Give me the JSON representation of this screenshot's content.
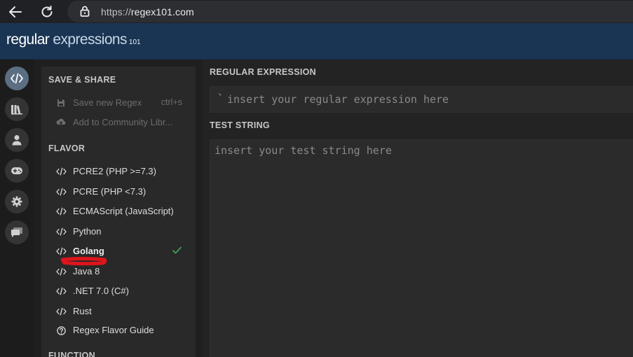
{
  "browser": {
    "url_protocol": "https://",
    "url_host": "regex101.com"
  },
  "header": {
    "brand_main": "regular",
    "brand_light": "expressions",
    "brand_sub": "101"
  },
  "rail": {
    "items": [
      {
        "icon": "code-icon",
        "active": true
      },
      {
        "icon": "library-icon",
        "active": false
      },
      {
        "icon": "user-icon",
        "active": false
      },
      {
        "icon": "gamepad-icon",
        "active": false
      },
      {
        "icon": "gear-icon",
        "active": false
      },
      {
        "icon": "chat-icon",
        "active": false
      }
    ]
  },
  "sidebar": {
    "save_share_title": "SAVE & SHARE",
    "save_new": "Save new Regex",
    "save_shortcut": "ctrl+s",
    "add_community": "Add to Community Libr...",
    "flavor_title": "FLAVOR",
    "flavors": [
      {
        "label": "PCRE2 (PHP >=7.3)",
        "selected": false
      },
      {
        "label": "PCRE (PHP <7.3)",
        "selected": false
      },
      {
        "label": "ECMAScript (JavaScript)",
        "selected": false
      },
      {
        "label": "Python",
        "selected": false
      },
      {
        "label": "Golang",
        "selected": true
      },
      {
        "label": "Java 8",
        "selected": false
      },
      {
        "label": ".NET 7.0 (C#)",
        "selected": false
      },
      {
        "label": "Rust",
        "selected": false
      }
    ],
    "flavor_guide": "Regex Flavor Guide",
    "function_title": "FUNCTION"
  },
  "main": {
    "regex_title": "REGULAR EXPRESSION",
    "regex_delimiter": "`",
    "regex_placeholder": "insert your regular expression here",
    "test_title": "TEST STRING",
    "test_placeholder": "insert your test string here"
  },
  "colors": {
    "header_bg": "#1a3553",
    "rail_active": "#5b6e82",
    "check_green": "#3fae5a",
    "annotation_red": "#e0141b"
  }
}
